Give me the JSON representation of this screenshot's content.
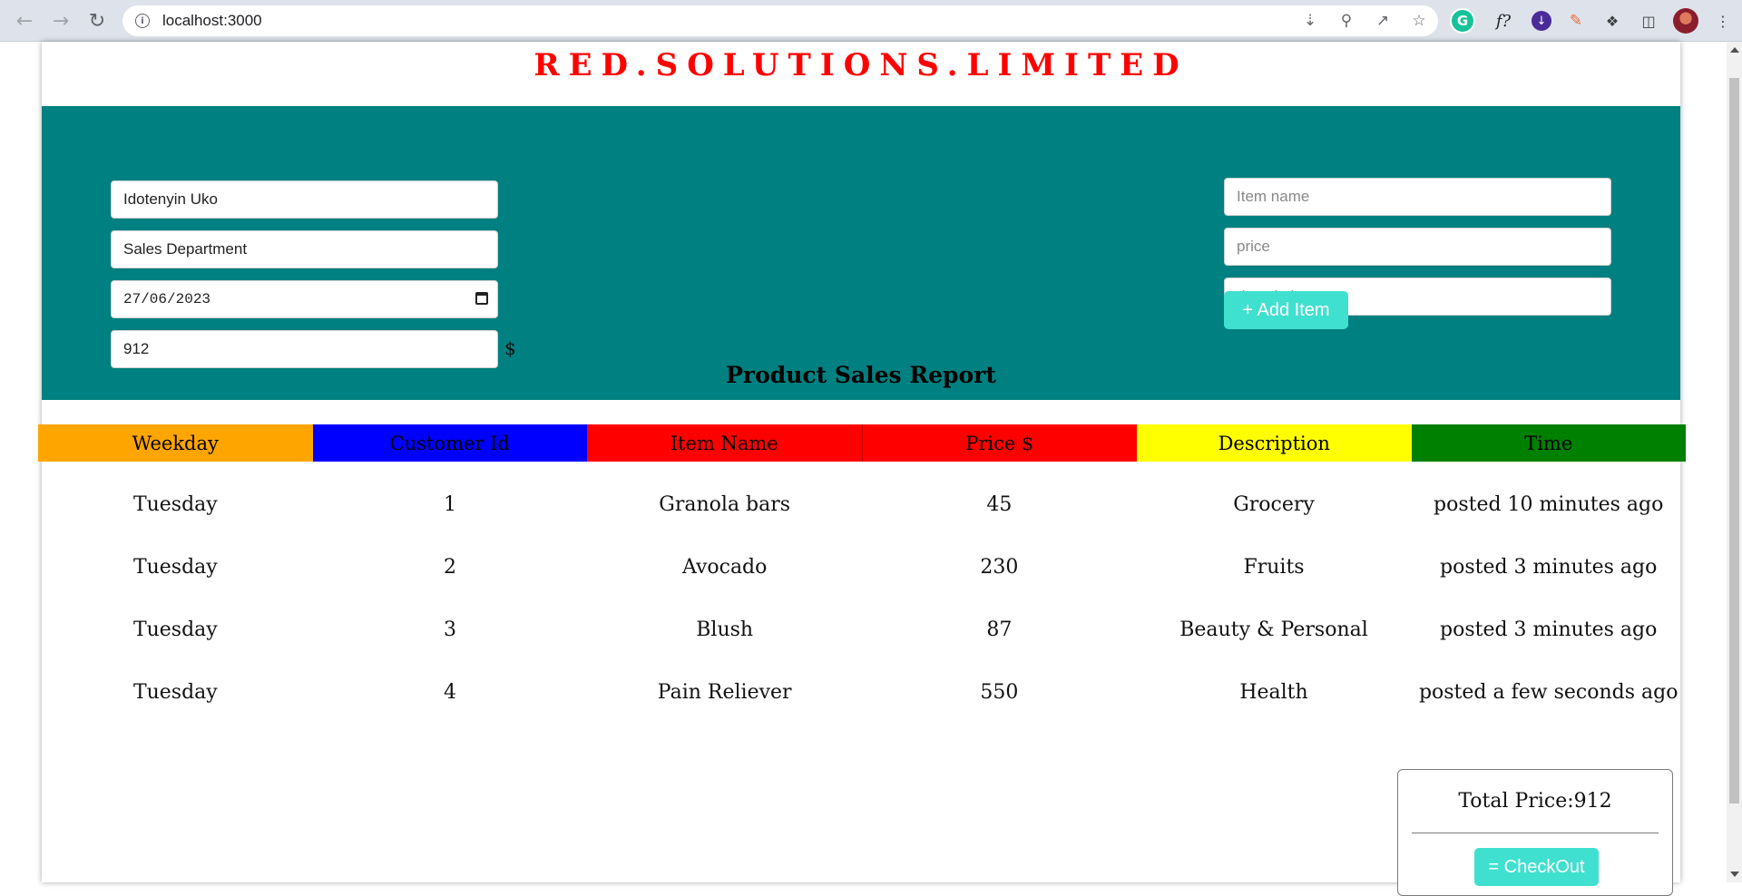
{
  "browser": {
    "url": "localhost:3000",
    "back_icon": "arrow-left-icon",
    "forward_icon": "arrow-right-icon",
    "reload_icon": "reload-icon",
    "extensions": [
      "grammarly-icon",
      "fx-icon",
      "download-manager-icon",
      "pen-icon",
      "puzzle-icon",
      "side-panel-icon",
      "profile-avatar",
      "kebab-menu-icon"
    ]
  },
  "header": {
    "brand": "RED.SOLUTIONS.LIMITED",
    "brand_color": "#ff0000"
  },
  "form": {
    "name_value": "Idotenyin Uko",
    "department_value": "Sales Department",
    "date_value": "27/06/2023",
    "amount_value": "912",
    "currency_symbol": "$",
    "item_name_placeholder": "Item name",
    "price_placeholder": "price",
    "description_placeholder": "description",
    "add_button_label": "+ Add Item",
    "panel_color": "#008080",
    "button_color": "#40e0d0"
  },
  "report": {
    "title": "Product Sales Report",
    "columns": [
      {
        "label": "Weekday",
        "bg": "#ffa500"
      },
      {
        "label": "Customer Id",
        "bg": "#0000ff"
      },
      {
        "label": "Item Name",
        "bg": "#ff0000"
      },
      {
        "label": "Price $",
        "bg": "#ff0000"
      },
      {
        "label": "Description",
        "bg": "#ffff00"
      },
      {
        "label": "Time",
        "bg": "#008000"
      }
    ],
    "rows": [
      [
        "Tuesday",
        "1",
        "Granola bars",
        "45",
        "Grocery",
        "posted 10 minutes ago"
      ],
      [
        "Tuesday",
        "2",
        "Avocado",
        "230",
        "Fruits",
        "posted 3 minutes ago"
      ],
      [
        "Tuesday",
        "3",
        "Blush",
        "87",
        "Beauty & Personal",
        "posted 3 minutes ago"
      ],
      [
        "Tuesday",
        "4",
        "Pain Reliever",
        "550",
        "Health",
        "posted a few seconds ago"
      ]
    ]
  },
  "summary": {
    "total_label": "Total Price:912",
    "checkout_label": "= CheckOut"
  }
}
